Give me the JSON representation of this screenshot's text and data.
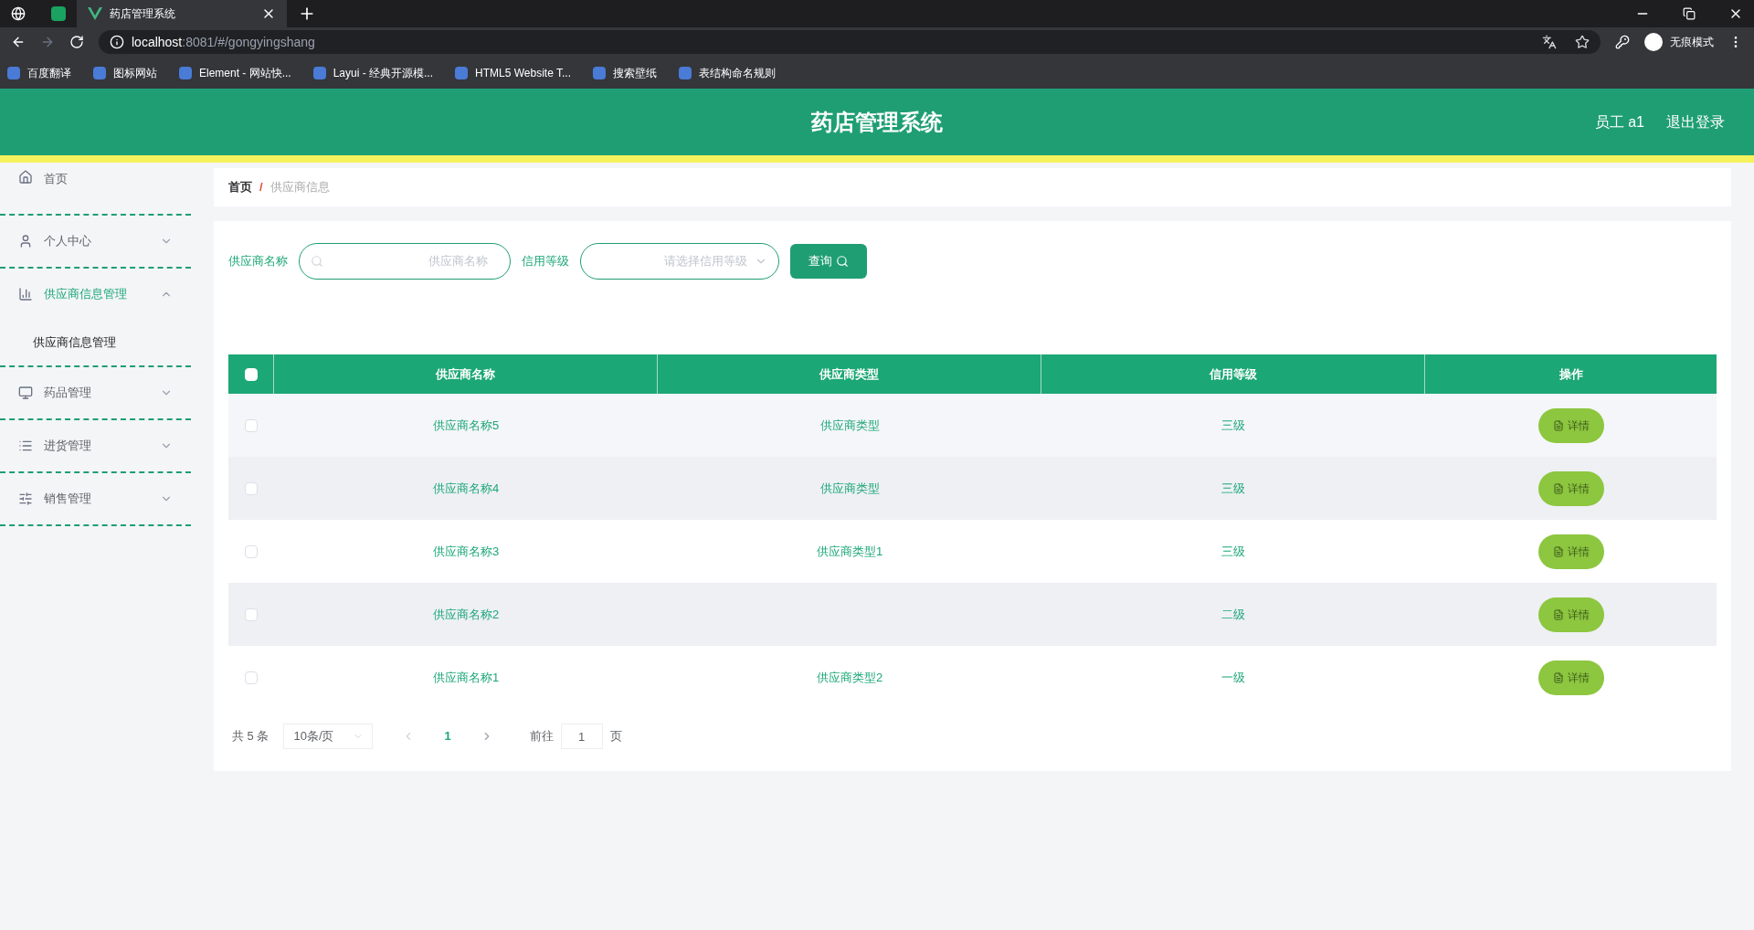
{
  "browser": {
    "tabs": [
      {
        "title": "药店管理系统",
        "selected": true
      }
    ],
    "address": {
      "host": "localhost",
      "path": ":8081/#/gongyingshang"
    },
    "profile": "无痕模式",
    "bookmarks": [
      "百度翻译",
      "图标网站",
      "Element - 网站快...",
      "Layui - 经典开源模...",
      "HTML5 Website T...",
      "搜索壁纸",
      "表结构命名规则"
    ]
  },
  "header": {
    "title": "药店管理系统",
    "user": "员工 a1",
    "logout": "退出登录"
  },
  "sidebar": {
    "items": [
      {
        "label": "首页",
        "expanded": false,
        "has_arrow": false
      },
      {
        "label": "个人中心",
        "expanded": false,
        "has_arrow": true
      },
      {
        "label": "供应商信息管理",
        "expanded": true,
        "has_arrow": true,
        "children": [
          {
            "label": "供应商信息管理"
          }
        ]
      },
      {
        "label": "药品管理",
        "expanded": false,
        "has_arrow": true
      },
      {
        "label": "进货管理",
        "expanded": false,
        "has_arrow": true
      },
      {
        "label": "销售管理",
        "expanded": false,
        "has_arrow": true
      }
    ]
  },
  "breadcrumb": {
    "items": [
      "首页",
      "供应商信息"
    ],
    "separator": "/"
  },
  "search": {
    "name_label": "供应商名称",
    "name_placeholder": "供应商名称",
    "level_label": "信用等级",
    "level_placeholder": "请选择信用等级",
    "button": "查询"
  },
  "table": {
    "all_checked": false,
    "columns": [
      "供应商名称",
      "供应商类型",
      "信用等级",
      "操作"
    ],
    "rows": [
      {
        "name": "供应商名称5",
        "type": "供应商类型",
        "level": "三级",
        "action": "详情",
        "checked": false
      },
      {
        "name": "供应商名称4",
        "type": "供应商类型",
        "level": "三级",
        "action": "详情",
        "checked": false
      },
      {
        "name": "供应商名称3",
        "type": "供应商类型1",
        "level": "三级",
        "action": "详情",
        "checked": false
      },
      {
        "name": "供应商名称2",
        "level": "二级",
        "action": "详情",
        "checked": false
      },
      {
        "name": "供应商名称1",
        "type": "供应商类型2",
        "level": "一级",
        "action": "详情",
        "checked": false
      }
    ]
  },
  "pagination": {
    "total": "共 5 条",
    "page_size": "10条/页",
    "pages": [
      {
        "label": "1",
        "selected": true
      }
    ],
    "goto_label": "前往",
    "goto_value": "1",
    "goto_suffix": "页"
  }
}
